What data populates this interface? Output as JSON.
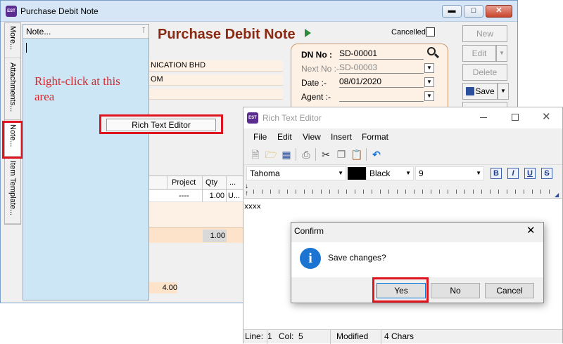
{
  "main": {
    "title": "Purchase Debit Note",
    "app_icon_text": "EST",
    "form_title": "Purchase Debit Note",
    "cancelled_label": "Cancelled",
    "company_text": "NICATION BHD",
    "address_text": "OM",
    "dn_no_label": "DN No :",
    "dn_no_value": "SD-00001",
    "next_no_label": "Next No :-",
    "next_no_value": "SD-00003",
    "date_label": "Date :-",
    "date_value": "08/01/2020",
    "agent_label": "Agent :-",
    "buttons": {
      "new": "New",
      "edit": "Edit",
      "delete": "Delete",
      "save": "Save"
    },
    "grid": {
      "headers": [
        "Project",
        "Qty",
        "..."
      ],
      "row": [
        "----",
        "1.00",
        "U..."
      ],
      "total_qty": "1.00",
      "footer_value": "4.00"
    }
  },
  "side_tabs": [
    "More...",
    "Attachments...",
    "Note...",
    "Item Template..."
  ],
  "note_panel": {
    "header": "Note...",
    "hint": "Right-click at this area"
  },
  "context_menu": {
    "item": "Rich Text Editor"
  },
  "rte": {
    "title": "Rich Text Editor",
    "menu": [
      "File",
      "Edit",
      "View",
      "Insert",
      "Format"
    ],
    "font": "Tahoma",
    "color_name": "Black",
    "size": "9",
    "format_buttons": [
      "B",
      "I",
      "U",
      "S"
    ],
    "content": "xxxx",
    "status": {
      "line_label": "Line:",
      "line_value": "1",
      "col_label": "Col:",
      "col_value": "5",
      "modified": "Modified",
      "chars": "4 Chars"
    }
  },
  "confirm": {
    "title": "Confirm",
    "message": "Save changes?",
    "buttons": {
      "yes": "Yes",
      "no": "No",
      "cancel": "Cancel"
    }
  },
  "colors": {
    "highlight_red": "#e0141e",
    "note_bg": "#cce6f5",
    "form_title": "#8b2a12",
    "info_blue": "#1b74d1"
  }
}
